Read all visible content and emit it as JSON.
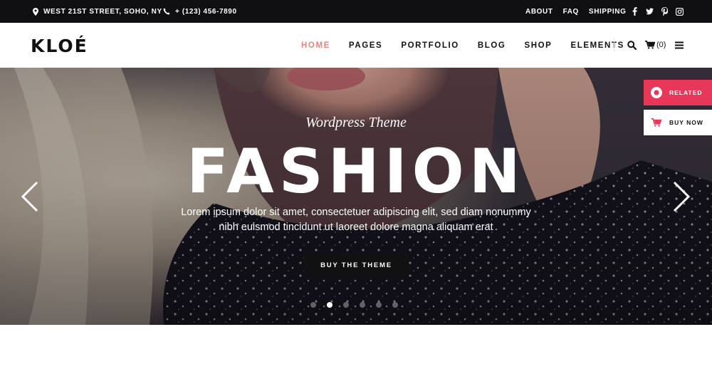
{
  "topbar": {
    "address": "WEST 21ST STREET, SOHO, NY",
    "phone": "+ (123) 456-7890",
    "links": [
      "ABOUT",
      "FAQ",
      "SHIPPING"
    ],
    "social_icons": [
      "facebook-icon",
      "twitter-icon",
      "pinterest-icon",
      "instagram-icon"
    ]
  },
  "header": {
    "logo": "KLOÉ",
    "nav": [
      "HOME",
      "PAGES",
      "PORTFOLIO",
      "BLOG",
      "SHOP",
      "ELEMENTS"
    ],
    "active_nav": "HOME",
    "cart_count": "(0)"
  },
  "hero": {
    "subtitle": "Wordpress Theme",
    "title": "FASHION",
    "text": "Lorem ipsum dolor sit amet, consectetuer adipiscing elit, sed diam nonummy nibh euismod tincidunt ut laoreet dolore magna aliquam erat",
    "button": "BUY THE THEME",
    "slide_count": 6,
    "active_slide": 2
  },
  "side": {
    "related": "RELATED",
    "buy_now": "BUY NOW"
  },
  "colors": {
    "accent": "#e8847c",
    "related_bg": "#e8385a",
    "topbar_bg": "#0f0f12",
    "button_bg": "#111111"
  }
}
